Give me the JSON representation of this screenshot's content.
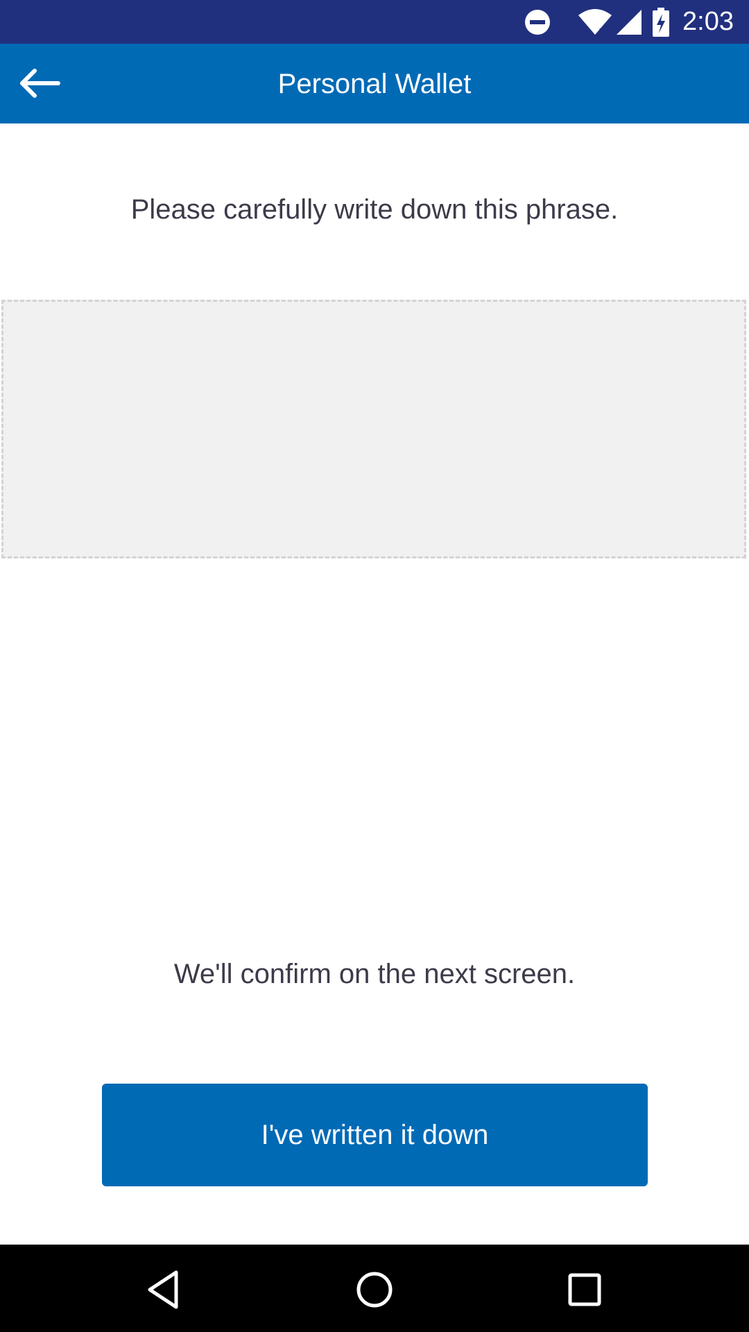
{
  "status_bar": {
    "time": "2:03",
    "icons": [
      "do-not-disturb-icon",
      "wifi-icon",
      "signal-icon",
      "battery-charging-icon"
    ]
  },
  "app_bar": {
    "title": "Personal Wallet",
    "back_icon": "arrow-left-icon"
  },
  "main": {
    "instruction": "Please carefully write down this phrase.",
    "phrase": "",
    "confirm_note": "We'll confirm on the next screen.",
    "primary_button_label": "I've written it down"
  },
  "nav_bar": {
    "icons": [
      "back-triangle-icon",
      "home-circle-icon",
      "recents-square-icon"
    ]
  },
  "colors": {
    "status_bar": "#21307e",
    "app_bar": "#016ab5",
    "accent": "#016ab5",
    "text": "#3c3b4a",
    "phrase_box": "#f1f1f1"
  }
}
